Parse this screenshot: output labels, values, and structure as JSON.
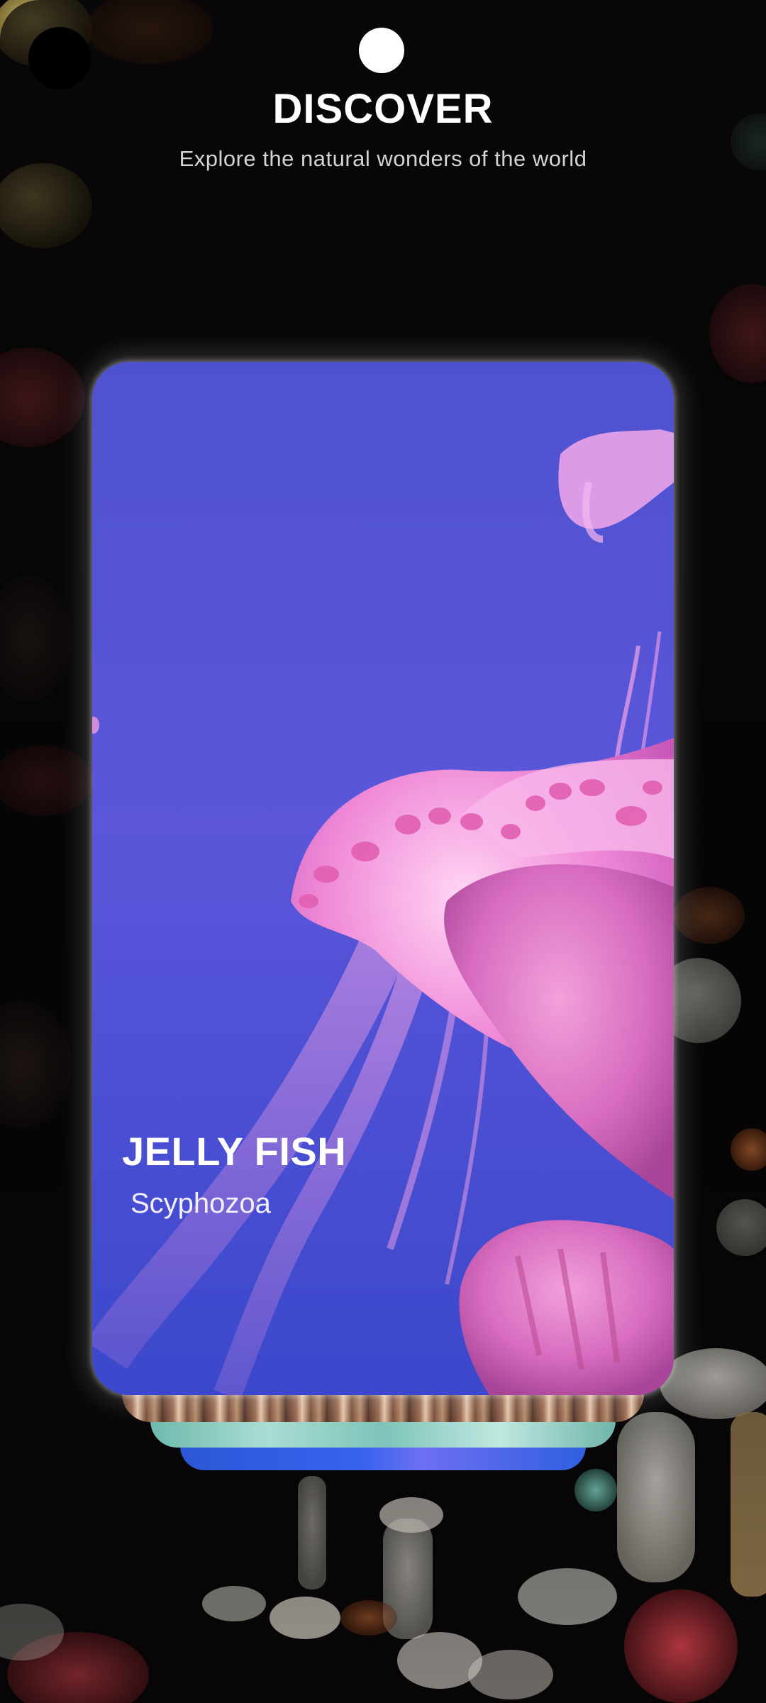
{
  "header": {
    "title": "DISCOVER",
    "subtitle": "Explore the natural wonders of the world"
  },
  "featured_card": {
    "title": "JELLY FISH",
    "subtitle": "Scyphozoa",
    "image": "jellyfish-photo",
    "accent_color": "#5a55d8"
  },
  "stacked_cards": [
    {
      "image": "coral-reef-photo"
    },
    {
      "image": "turquoise-water-photo"
    },
    {
      "image": "blue-ocean-photo"
    }
  ],
  "background": {
    "image": "sea-anemone-reef-photo",
    "color": "#060405"
  }
}
